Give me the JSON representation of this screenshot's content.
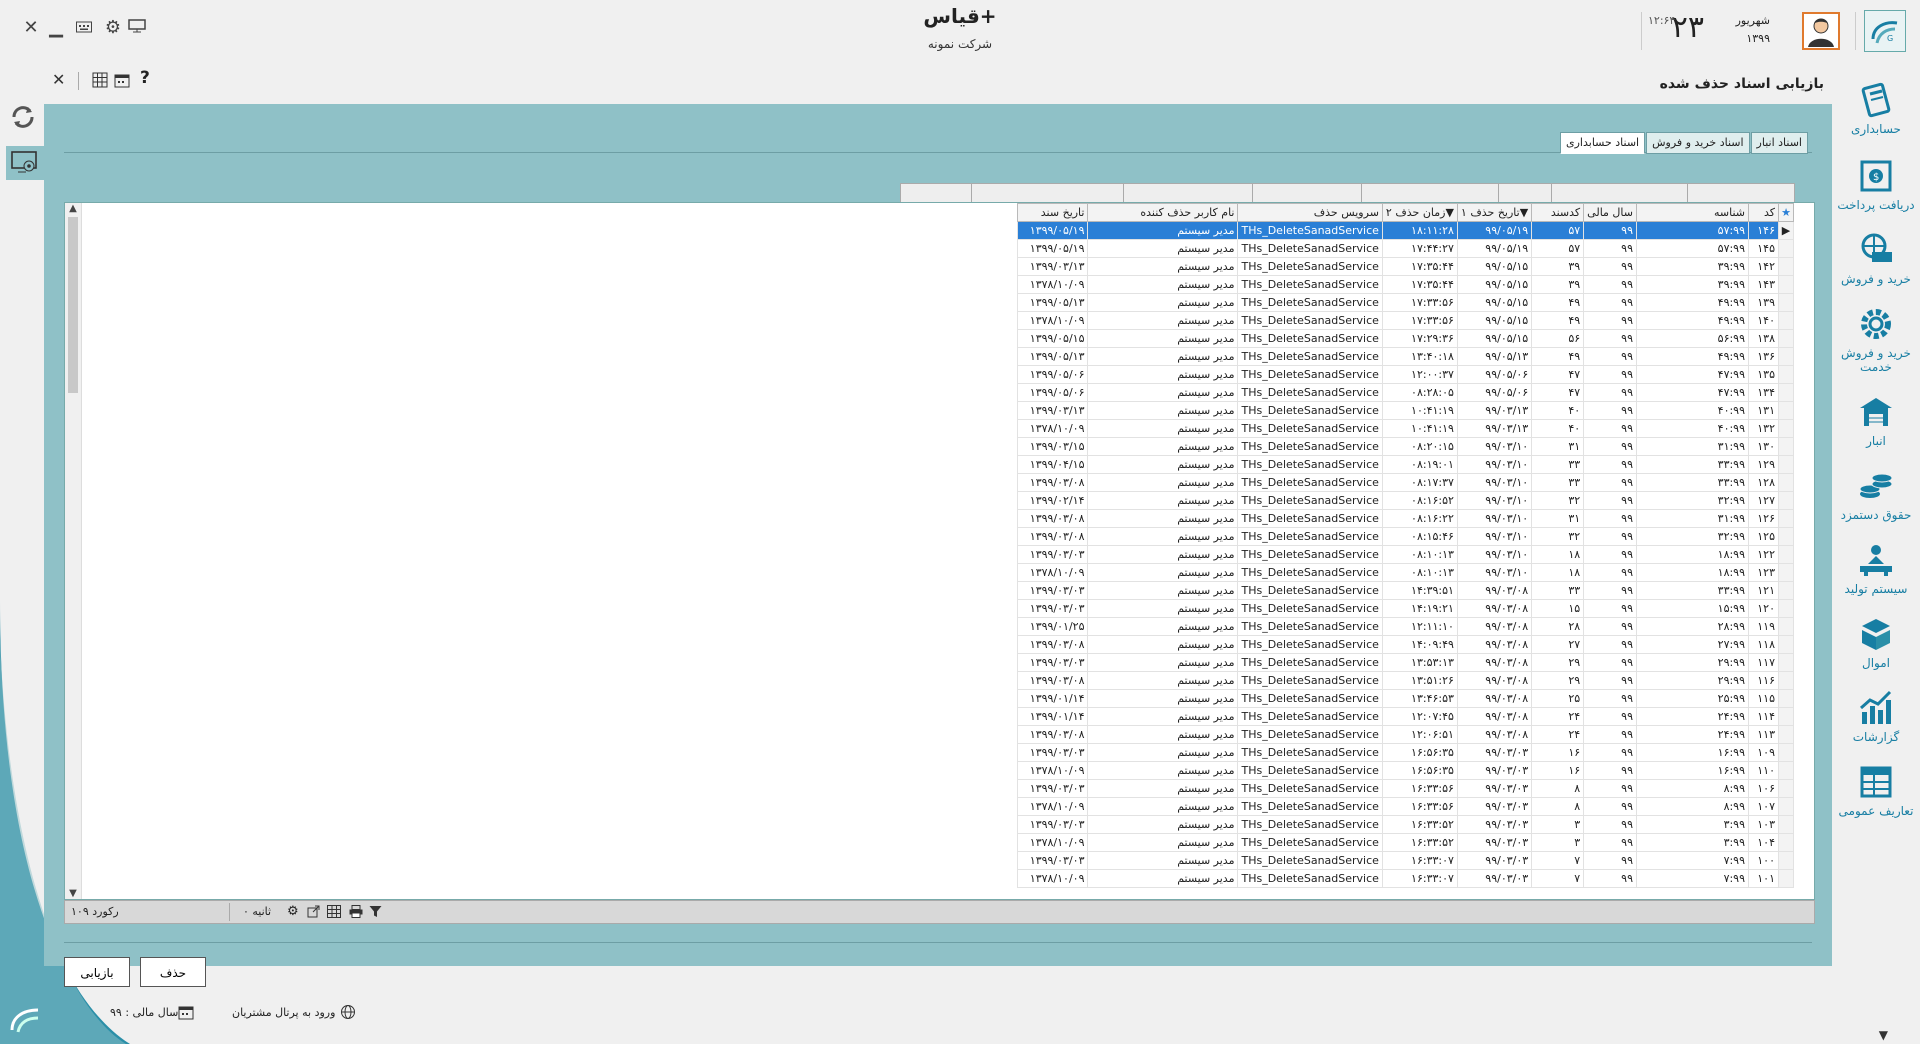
{
  "app": {
    "title": "قیاس+",
    "company": "شرکت نمونه",
    "clock_day": "۲۳",
    "clock_month": "شهریور",
    "clock_year": "۱۳۹۹",
    "clock_time": "۱۲:۶۴"
  },
  "sidebar": {
    "items": [
      {
        "label": "حسابداری",
        "icon": "accounting-icon"
      },
      {
        "label": "دریافت پرداخت",
        "icon": "payment-icon"
      },
      {
        "label": "خرید و فروش",
        "icon": "shopping-basket-icon"
      },
      {
        "label": "خرید و فروش خدمت",
        "icon": "service-gear-icon"
      },
      {
        "label": "انبار",
        "icon": "warehouse-icon"
      },
      {
        "label": "حقوق دستمزد",
        "icon": "coins-icon"
      },
      {
        "label": "سیستم تولید",
        "icon": "production-icon"
      },
      {
        "label": "اموال",
        "icon": "assets-box-icon"
      },
      {
        "label": "گزارشات",
        "icon": "reports-chart-icon"
      },
      {
        "label": "تعاریف عمومی",
        "icon": "definitions-table-icon"
      }
    ]
  },
  "page": {
    "title": "بازیابی اسناد حذف شده",
    "tabs": [
      {
        "label": "اسناد انبار",
        "active": false
      },
      {
        "label": "اسناد خرید و فروش",
        "active": false
      },
      {
        "label": "اسناد حسابداری",
        "active": true
      }
    ]
  },
  "grid": {
    "columns": [
      "کد",
      "شناسه",
      "سال مالی",
      "کدسند",
      "تاریخ حذف ۱",
      "زمان حذف ۲",
      "سرویس حذف",
      "نام کاربر حذف کننده",
      "تاریخ سند"
    ],
    "rows": [
      [
        "۱۴۶",
        "۵۷:۹۹",
        "۹۹",
        "۵۷",
        "۹۹/۰۵/۱۹",
        "۱۸:۱۱:۲۸",
        "THs_DeleteSanadService",
        "مدیر سیستم",
        "۱۳۹۹/۰۵/۱۹"
      ],
      [
        "۱۴۵",
        "۵۷:۹۹",
        "۹۹",
        "۵۷",
        "۹۹/۰۵/۱۹",
        "۱۷:۴۴:۲۷",
        "THs_DeleteSanadService",
        "مدیر سیستم",
        "۱۳۹۹/۰۵/۱۹"
      ],
      [
        "۱۴۲",
        "۳۹:۹۹",
        "۹۹",
        "۳۹",
        "۹۹/۰۵/۱۵",
        "۱۷:۳۵:۴۴",
        "THs_DeleteSanadService",
        "مدیر سیستم",
        "۱۳۹۹/۰۳/۱۳"
      ],
      [
        "۱۴۳",
        "۳۹:۹۹",
        "۹۹",
        "۳۹",
        "۹۹/۰۵/۱۵",
        "۱۷:۳۵:۴۴",
        "THs_DeleteSanadService",
        "مدیر سیستم",
        "۱۳۷۸/۱۰/۰۹"
      ],
      [
        "۱۳۹",
        "۴۹:۹۹",
        "۹۹",
        "۴۹",
        "۹۹/۰۵/۱۵",
        "۱۷:۳۳:۵۶",
        "THs_DeleteSanadService",
        "مدیر سیستم",
        "۱۳۹۹/۰۵/۱۳"
      ],
      [
        "۱۴۰",
        "۴۹:۹۹",
        "۹۹",
        "۴۹",
        "۹۹/۰۵/۱۵",
        "۱۷:۳۳:۵۶",
        "THs_DeleteSanadService",
        "مدیر سیستم",
        "۱۳۷۸/۱۰/۰۹"
      ],
      [
        "۱۳۸",
        "۵۶:۹۹",
        "۹۹",
        "۵۶",
        "۹۹/۰۵/۱۵",
        "۱۷:۲۹:۳۶",
        "THs_DeleteSanadService",
        "مدیر سیستم",
        "۱۳۹۹/۰۵/۱۵"
      ],
      [
        "۱۳۶",
        "۴۹:۹۹",
        "۹۹",
        "۴۹",
        "۹۹/۰۵/۱۳",
        "۱۳:۴۰:۱۸",
        "THs_DeleteSanadService",
        "مدیر سیستم",
        "۱۳۹۹/۰۵/۱۳"
      ],
      [
        "۱۳۵",
        "۴۷:۹۹",
        "۹۹",
        "۴۷",
        "۹۹/۰۵/۰۶",
        "۱۲:۰۰:۳۷",
        "THs_DeleteSanadService",
        "مدیر سیستم",
        "۱۳۹۹/۰۵/۰۶"
      ],
      [
        "۱۳۴",
        "۴۷:۹۹",
        "۹۹",
        "۴۷",
        "۹۹/۰۵/۰۶",
        "۰۸:۲۸:۰۵",
        "THs_DeleteSanadService",
        "مدیر سیستم",
        "۱۳۹۹/۰۵/۰۶"
      ],
      [
        "۱۳۱",
        "۴۰:۹۹",
        "۹۹",
        "۴۰",
        "۹۹/۰۳/۱۳",
        "۱۰:۴۱:۱۹",
        "THs_DeleteSanadService",
        "مدیر سیستم",
        "۱۳۹۹/۰۳/۱۳"
      ],
      [
        "۱۳۲",
        "۴۰:۹۹",
        "۹۹",
        "۴۰",
        "۹۹/۰۳/۱۳",
        "۱۰:۴۱:۱۹",
        "THs_DeleteSanadService",
        "مدیر سیستم",
        "۱۳۷۸/۱۰/۰۹"
      ],
      [
        "۱۳۰",
        "۳۱:۹۹",
        "۹۹",
        "۳۱",
        "۹۹/۰۳/۱۰",
        "۰۸:۲۰:۱۵",
        "THs_DeleteSanadService",
        "مدیر سیستم",
        "۱۳۹۹/۰۳/۱۵"
      ],
      [
        "۱۲۹",
        "۳۳:۹۹",
        "۹۹",
        "۳۳",
        "۹۹/۰۳/۱۰",
        "۰۸:۱۹:۰۱",
        "THs_DeleteSanadService",
        "مدیر سیستم",
        "۱۳۹۹/۰۴/۱۵"
      ],
      [
        "۱۲۸",
        "۳۳:۹۹",
        "۹۹",
        "۳۳",
        "۹۹/۰۳/۱۰",
        "۰۸:۱۷:۳۷",
        "THs_DeleteSanadService",
        "مدیر سیستم",
        "۱۳۹۹/۰۳/۰۸"
      ],
      [
        "۱۲۷",
        "۳۲:۹۹",
        "۹۹",
        "۳۲",
        "۹۹/۰۳/۱۰",
        "۰۸:۱۶:۵۲",
        "THs_DeleteSanadService",
        "مدیر سیستم",
        "۱۳۹۹/۰۲/۱۴"
      ],
      [
        "۱۲۶",
        "۳۱:۹۹",
        "۹۹",
        "۳۱",
        "۹۹/۰۳/۱۰",
        "۰۸:۱۶:۲۲",
        "THs_DeleteSanadService",
        "مدیر سیستم",
        "۱۳۹۹/۰۳/۰۸"
      ],
      [
        "۱۲۵",
        "۳۲:۹۹",
        "۹۹",
        "۳۲",
        "۹۹/۰۳/۱۰",
        "۰۸:۱۵:۴۶",
        "THs_DeleteSanadService",
        "مدیر سیستم",
        "۱۳۹۹/۰۳/۰۸"
      ],
      [
        "۱۲۲",
        "۱۸:۹۹",
        "۹۹",
        "۱۸",
        "۹۹/۰۳/۱۰",
        "۰۸:۱۰:۱۳",
        "THs_DeleteSanadService",
        "مدیر سیستم",
        "۱۳۹۹/۰۳/۰۳"
      ],
      [
        "۱۲۳",
        "۱۸:۹۹",
        "۹۹",
        "۱۸",
        "۹۹/۰۳/۱۰",
        "۰۸:۱۰:۱۳",
        "THs_DeleteSanadService",
        "مدیر سیستم",
        "۱۳۷۸/۱۰/۰۹"
      ],
      [
        "۱۲۱",
        "۳۳:۹۹",
        "۹۹",
        "۳۳",
        "۹۹/۰۳/۰۸",
        "۱۴:۳۹:۵۱",
        "THs_DeleteSanadService",
        "مدیر سیستم",
        "۱۳۹۹/۰۳/۰۳"
      ],
      [
        "۱۲۰",
        "۱۵:۹۹",
        "۹۹",
        "۱۵",
        "۹۹/۰۳/۰۸",
        "۱۴:۱۹:۲۱",
        "THs_DeleteSanadService",
        "مدیر سیستم",
        "۱۳۹۹/۰۳/۰۳"
      ],
      [
        "۱۱۹",
        "۲۸:۹۹",
        "۹۹",
        "۲۸",
        "۹۹/۰۳/۰۸",
        "۱۲:۱۱:۱۰",
        "THs_DeleteSanadService",
        "مدیر سیستم",
        "۱۳۹۹/۰۱/۲۵"
      ],
      [
        "۱۱۸",
        "۲۷:۹۹",
        "۹۹",
        "۲۷",
        "۹۹/۰۳/۰۸",
        "۱۴:۰۹:۴۹",
        "THs_DeleteSanadService",
        "مدیر سیستم",
        "۱۳۹۹/۰۳/۰۸"
      ],
      [
        "۱۱۷",
        "۲۹:۹۹",
        "۹۹",
        "۲۹",
        "۹۹/۰۳/۰۸",
        "۱۳:۵۳:۱۳",
        "THs_DeleteSanadService",
        "مدیر سیستم",
        "۱۳۹۹/۰۳/۰۳"
      ],
      [
        "۱۱۶",
        "۲۹:۹۹",
        "۹۹",
        "۲۹",
        "۹۹/۰۳/۰۸",
        "۱۳:۵۱:۲۶",
        "THs_DeleteSanadService",
        "مدیر سیستم",
        "۱۳۹۹/۰۳/۰۸"
      ],
      [
        "۱۱۵",
        "۲۵:۹۹",
        "۹۹",
        "۲۵",
        "۹۹/۰۳/۰۸",
        "۱۳:۴۶:۵۳",
        "THs_DeleteSanadService",
        "مدیر سیستم",
        "۱۳۹۹/۰۱/۱۴"
      ],
      [
        "۱۱۴",
        "۲۴:۹۹",
        "۹۹",
        "۲۴",
        "۹۹/۰۳/۰۸",
        "۱۲:۰۷:۴۵",
        "THs_DeleteSanadService",
        "مدیر سیستم",
        "۱۳۹۹/۰۱/۱۴"
      ],
      [
        "۱۱۳",
        "۲۴:۹۹",
        "۹۹",
        "۲۴",
        "۹۹/۰۳/۰۸",
        "۱۲:۰۶:۵۱",
        "THs_DeleteSanadService",
        "مدیر سیستم",
        "۱۳۹۹/۰۳/۰۸"
      ],
      [
        "۱۰۹",
        "۱۶:۹۹",
        "۹۹",
        "۱۶",
        "۹۹/۰۳/۰۳",
        "۱۶:۵۶:۳۵",
        "THs_DeleteSanadService",
        "مدیر سیستم",
        "۱۳۹۹/۰۳/۰۳"
      ],
      [
        "۱۱۰",
        "۱۶:۹۹",
        "۹۹",
        "۱۶",
        "۹۹/۰۳/۰۳",
        "۱۶:۵۶:۳۵",
        "THs_DeleteSanadService",
        "مدیر سیستم",
        "۱۳۷۸/۱۰/۰۹"
      ],
      [
        "۱۰۶",
        "۸:۹۹",
        "۹۹",
        "۸",
        "۹۹/۰۳/۰۳",
        "۱۶:۳۳:۵۶",
        "THs_DeleteSanadService",
        "مدیر سیستم",
        "۱۳۹۹/۰۳/۰۳"
      ],
      [
        "۱۰۷",
        "۸:۹۹",
        "۹۹",
        "۸",
        "۹۹/۰۳/۰۳",
        "۱۶:۳۳:۵۶",
        "THs_DeleteSanadService",
        "مدیر سیستم",
        "۱۳۷۸/۱۰/۰۹"
      ],
      [
        "۱۰۳",
        "۳:۹۹",
        "۹۹",
        "۳",
        "۹۹/۰۳/۰۳",
        "۱۶:۳۳:۵۲",
        "THs_DeleteSanadService",
        "مدیر سیستم",
        "۱۳۹۹/۰۳/۰۳"
      ],
      [
        "۱۰۴",
        "۳:۹۹",
        "۹۹",
        "۳",
        "۹۹/۰۳/۰۳",
        "۱۶:۳۳:۵۲",
        "THs_DeleteSanadService",
        "مدیر سیستم",
        "۱۳۷۸/۱۰/۰۹"
      ],
      [
        "۱۰۰",
        "۷:۹۹",
        "۹۹",
        "۷",
        "۹۹/۰۳/۰۳",
        "۱۶:۳۳:۰۷",
        "THs_DeleteSanadService",
        "مدیر سیستم",
        "۱۳۹۹/۰۳/۰۳"
      ],
      [
        "۱۰۱",
        "۷:۹۹",
        "۹۹",
        "۷",
        "۹۹/۰۳/۰۳",
        "۱۶:۳۳:۰۷",
        "THs_DeleteSanadService",
        "مدیر سیستم",
        "۱۳۷۸/۱۰/۰۹"
      ]
    ]
  },
  "status": {
    "records": "۱۰۹ رکورد",
    "seconds": "۰ ثانیه"
  },
  "buttons": {
    "delete": "حذف",
    "restore": "بازیابی"
  },
  "footer": {
    "fiscal_year": "سال مالی : ۹۹",
    "portal": "ورود به پرتال مشتریان"
  },
  "colors": {
    "panel": "#8fc1c7",
    "accent": "#177ea3",
    "selection": "#2a7fd6"
  }
}
